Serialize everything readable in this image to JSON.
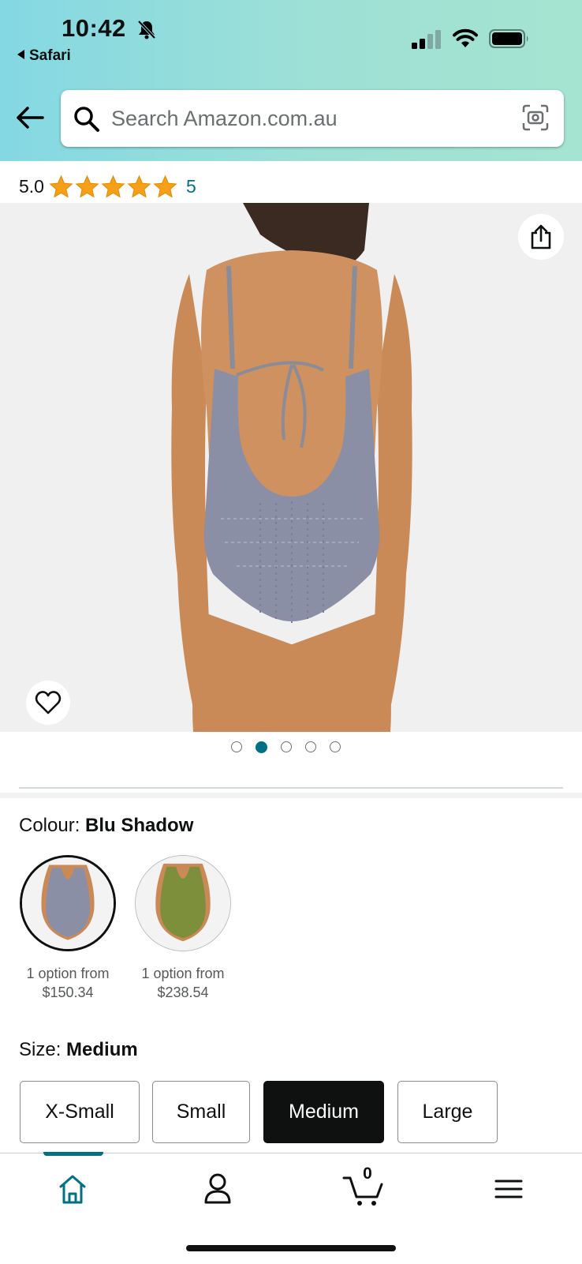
{
  "status_bar": {
    "time": "10:42",
    "back_app": "Safari",
    "icons": [
      "bell-slash-icon",
      "cellular-signal-icon",
      "wifi-icon",
      "battery-icon"
    ]
  },
  "search": {
    "placeholder": "Search Amazon.com.au",
    "value": ""
  },
  "rating": {
    "value": "5.0",
    "stars": 5,
    "count": "5"
  },
  "gallery": {
    "image_count": 5,
    "active_index": 1
  },
  "colour": {
    "label": "Colour: ",
    "selected": "Blu Shadow",
    "options": [
      {
        "line1": "1 option from",
        "price": "$150.34",
        "color": "#8a8fa6"
      },
      {
        "line1": "1 option from",
        "price": "$238.54",
        "color": "#7d8f3a"
      }
    ]
  },
  "size": {
    "label": "Size: ",
    "selected": "Medium",
    "options": [
      "X-Small",
      "Small",
      "Medium",
      "Large"
    ]
  },
  "bottom_nav": {
    "items": [
      "home-icon",
      "account-icon",
      "cart-icon",
      "menu-icon"
    ],
    "active": "home-icon",
    "cart_count": "0"
  },
  "colors": {
    "accent": "#007185",
    "star": "#f6a01a",
    "header_gradient_start": "#84d8e3",
    "header_gradient_end": "#a5e4d0"
  }
}
